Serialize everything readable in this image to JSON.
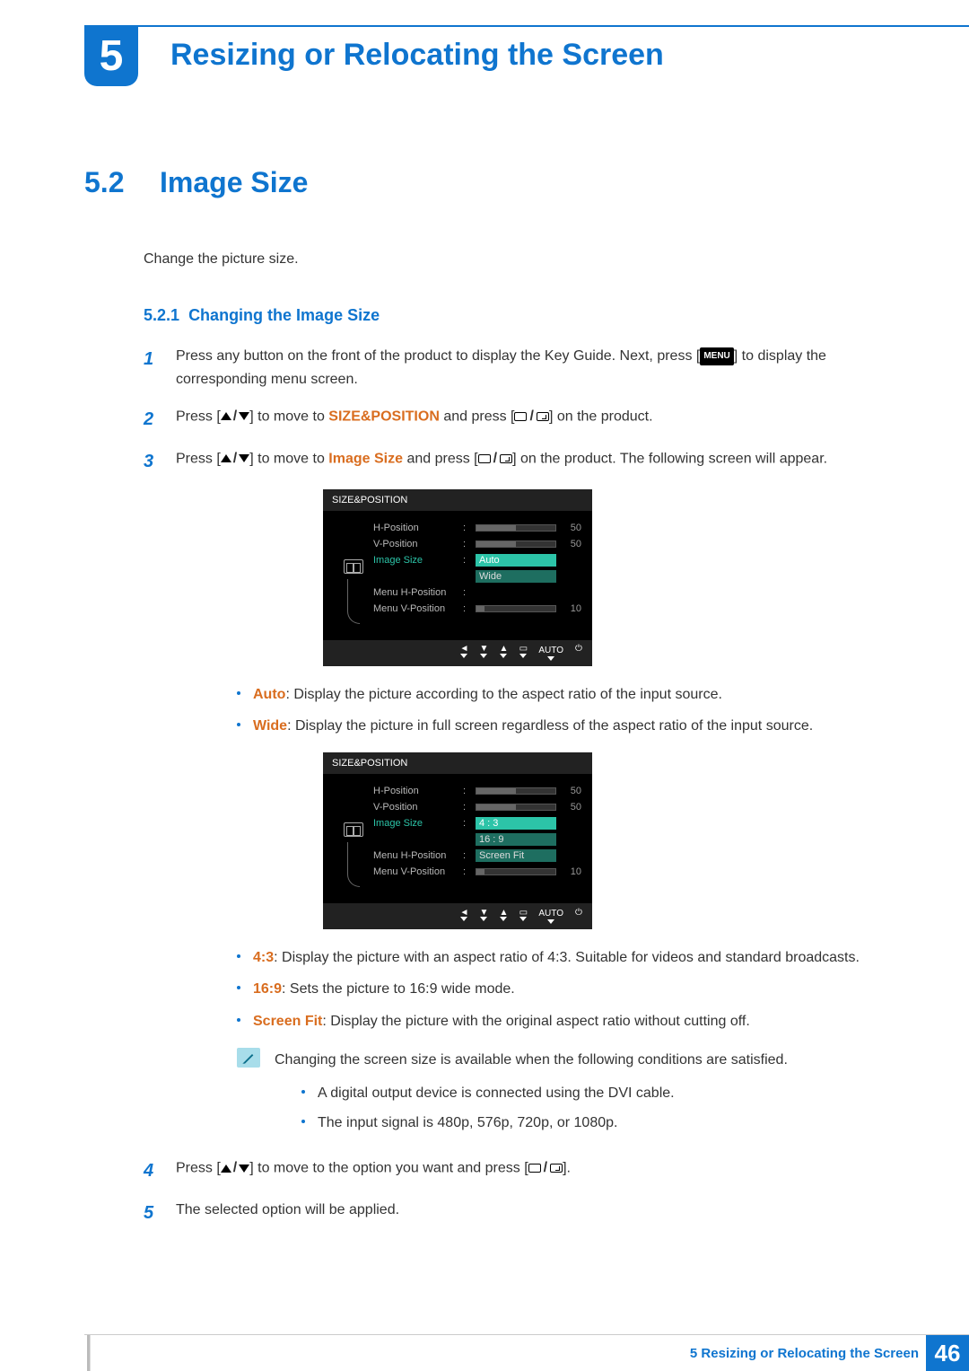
{
  "chapter": {
    "number": "5",
    "title": "Resizing or Relocating the Screen"
  },
  "section": {
    "number": "5.2",
    "title": "Image Size",
    "intro": "Change the picture size."
  },
  "subsection": {
    "number": "5.2.1",
    "title": "Changing the Image Size"
  },
  "steps": {
    "s1_a": "Press any button on the front of the product to display the Key Guide. Next, press [",
    "s1_menu": "MENU",
    "s1_b": "] to display the corresponding menu screen.",
    "s2_a": "Press [",
    "s2_b": "] to move to ",
    "s2_kw": "SIZE&POSITION",
    "s2_c": " and press [",
    "s2_d": "] on the product.",
    "s3_a": "Press [",
    "s3_b": "] to move to ",
    "s3_kw": "Image Size",
    "s3_c": " and press [",
    "s3_d": "] on the product. The following screen will appear.",
    "s4_a": "Press [",
    "s4_b": "] to move to the option you want and press [",
    "s4_c": "].",
    "s5": "The selected option will be applied."
  },
  "osd1": {
    "header": "SIZE&POSITION",
    "items": {
      "hpos": "H-Position",
      "vpos": "V-Position",
      "imgsize": "Image Size",
      "menuh": "Menu H-Position",
      "menuv": "Menu V-Position"
    },
    "values": {
      "hpos": "50",
      "vpos": "50",
      "menuv": "10"
    },
    "options": {
      "opt1": "Auto",
      "opt2": "Wide"
    },
    "footer_auto": "AUTO"
  },
  "osd2": {
    "header": "SIZE&POSITION",
    "items": {
      "hpos": "H-Position",
      "vpos": "V-Position",
      "imgsize": "Image Size",
      "menuh": "Menu H-Position",
      "menuv": "Menu V-Position"
    },
    "values": {
      "hpos": "50",
      "vpos": "50",
      "menuv": "10"
    },
    "options": {
      "opt1": "4 : 3",
      "opt2": "16 : 9",
      "opt3": "Screen Fit"
    },
    "footer_auto": "AUTO"
  },
  "defs1": {
    "auto_kw": "Auto",
    "auto_txt": ": Display the picture according to the aspect ratio of the input source.",
    "wide_kw": "Wide",
    "wide_txt": ": Display the picture in full screen regardless of the aspect ratio of the input source."
  },
  "defs2": {
    "a_kw": "4:3",
    "a_txt": ": Display the picture with an aspect ratio of 4:3. Suitable for videos and standard broadcasts.",
    "b_kw": "16:9",
    "b_txt": ": Sets the picture to 16:9 wide mode.",
    "c_kw": "Screen Fit",
    "c_txt": ": Display the picture with the original aspect ratio without cutting off."
  },
  "note": {
    "intro": "Changing the screen size is available when the following conditions are satisfied.",
    "cond1": "A digital output device is connected using the DVI cable.",
    "cond2": "The input signal is 480p, 576p, 720p, or 1080p."
  },
  "footer": {
    "title": "5 Resizing or Relocating the Screen",
    "page": "46"
  }
}
